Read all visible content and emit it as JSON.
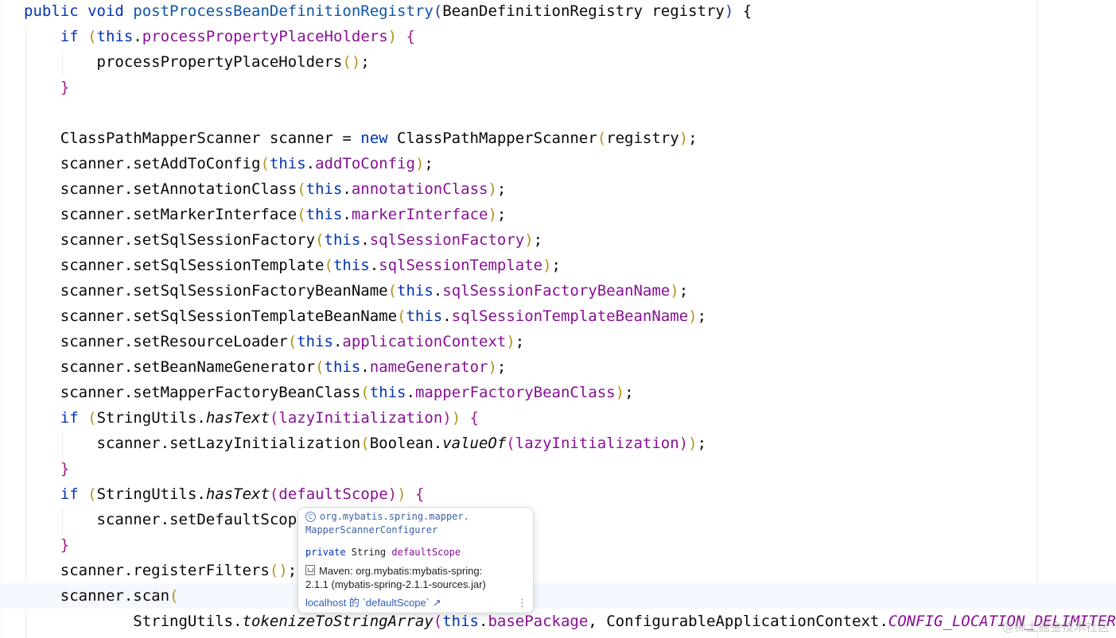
{
  "code": {
    "l1": {
      "a": "public",
      "b": " ",
      "c": "void",
      "d": " postProcessBeanDefinitionRegistry",
      "e": "(",
      "f": "BeanDefinitionRegistry registry",
      "g": ")",
      "h": " {"
    },
    "l2": {
      "ind": "    ",
      "kw": "if",
      "sp": " ",
      "o": "(",
      "th": "this",
      "dot": ".",
      "fld": "processPropertyPlaceHolders",
      "c": ")",
      "rest": " {"
    },
    "l3": {
      "ind": "        ",
      "t": "processPropertyPlaceHolders",
      "o": "(",
      "c": ")",
      "semi": ";"
    },
    "l4": {
      "ind": "    ",
      "b": "}"
    },
    "l6": {
      "ind": "    ",
      "t1": "ClassPathMapperScanner scanner = ",
      "kw": "new",
      "t2": " ClassPathMapperScanner",
      "o": "(",
      "arg": "registry",
      "c": ")",
      "semi": ";"
    },
    "l7": {
      "ind": "    ",
      "m": "scanner.setAddToConfig",
      "o": "(",
      "th": "this",
      "dot": ".",
      "fld": "addToConfig",
      "c": ")",
      "semi": ";"
    },
    "l8": {
      "ind": "    ",
      "m": "scanner.setAnnotationClass",
      "o": "(",
      "th": "this",
      "dot": ".",
      "fld": "annotationClass",
      "c": ")",
      "semi": ";"
    },
    "l9": {
      "ind": "    ",
      "m": "scanner.setMarkerInterface",
      "o": "(",
      "th": "this",
      "dot": ".",
      "fld": "markerInterface",
      "c": ")",
      "semi": ";"
    },
    "l10": {
      "ind": "    ",
      "m": "scanner.setSqlSessionFactory",
      "o": "(",
      "th": "this",
      "dot": ".",
      "fld": "sqlSessionFactory",
      "c": ")",
      "semi": ";"
    },
    "l11": {
      "ind": "    ",
      "m": "scanner.setSqlSessionTemplate",
      "o": "(",
      "th": "this",
      "dot": ".",
      "fld": "sqlSessionTemplate",
      "c": ")",
      "semi": ";"
    },
    "l12": {
      "ind": "    ",
      "m": "scanner.setSqlSessionFactoryBeanName",
      "o": "(",
      "th": "this",
      "dot": ".",
      "fld": "sqlSessionFactoryBeanName",
      "c": ")",
      "semi": ";"
    },
    "l13": {
      "ind": "    ",
      "m": "scanner.setSqlSessionTemplateBeanName",
      "o": "(",
      "th": "this",
      "dot": ".",
      "fld": "sqlSessionTemplateBeanName",
      "c": ")",
      "semi": ";"
    },
    "l14": {
      "ind": "    ",
      "m": "scanner.setResourceLoader",
      "o": "(",
      "th": "this",
      "dot": ".",
      "fld": "applicationContext",
      "c": ")",
      "semi": ";"
    },
    "l15": {
      "ind": "    ",
      "m": "scanner.setBeanNameGenerator",
      "o": "(",
      "th": "this",
      "dot": ".",
      "fld": "nameGenerator",
      "c": ")",
      "semi": ";"
    },
    "l16": {
      "ind": "    ",
      "m": "scanner.setMapperFactoryBeanClass",
      "o": "(",
      "th": "this",
      "dot": ".",
      "fld": "mapperFactoryBeanClass",
      "c": ")",
      "semi": ";"
    },
    "l17": {
      "ind": "    ",
      "kw": "if",
      "sp": " ",
      "o1": "(",
      "t": "StringUtils.",
      "it": "hasText",
      "o2": "(",
      "fld": "lazyInitialization",
      "c2": ")",
      "c1": ")",
      "rest": " {"
    },
    "l18": {
      "ind": "        ",
      "t": "scanner.setLazyInitialization",
      "o1": "(",
      "t2": "Boolean.",
      "it": "valueOf",
      "o2": "(",
      "fld": "lazyInitialization",
      "c2": ")",
      "c1": ")",
      "semi": ";"
    },
    "l19": {
      "ind": "    ",
      "b": "}"
    },
    "l20": {
      "ind": "    ",
      "kw": "if",
      "sp": " ",
      "o1": "(",
      "t": "StringUtils.",
      "it": "hasText",
      "o2": "(",
      "fld": "defaultScope",
      "c2": ")",
      "c1": ")",
      "rest": " {"
    },
    "l21": {
      "ind": "        ",
      "t": "scanner.setDefaultScope"
    },
    "l22": {
      "ind": "    ",
      "b": "}"
    },
    "l23": {
      "ind": "    ",
      "t": "scanner.registerFilters",
      "o": "(",
      "c": ")",
      "semi": ";"
    },
    "l24": {
      "ind": "    ",
      "t": "scanner.scan",
      "o": "("
    },
    "l25": {
      "ind": "            ",
      "t": "StringUtils.",
      "it": "tokenizeToStringArray",
      "o": "(",
      "th": "this",
      "dot": ".",
      "fld": "basePackage",
      "sep": ", ",
      "t2": "ConfigurableApplicationContext.",
      "const": "CONFIG_LOCATION_DELIMITERS",
      "c": ")",
      "semi": ");"
    }
  },
  "popup": {
    "pkg_line1": "org.mybatis.spring.mapper.",
    "pkg_line2": "MapperScannerConfigurer",
    "decl_kw": "private",
    "decl_type": " String ",
    "decl_name": "defaultScope",
    "maven_line1": "Maven: org.mybatis:mybatis-spring:",
    "maven_line2": "2.1.1 (mybatis-spring-2.1.1-sources.jar)",
    "link_text": "localhost 的 `defaultScope`",
    "link_arrow": "↗",
    "more": "⋮"
  },
  "watermark": "@稀土掘金技术社区",
  "icons": [
    "class-icon",
    "jar-icon",
    "external-link-icon",
    "more-options-icon"
  ],
  "colors": {
    "keyword": "#0033b3",
    "field": "#871094",
    "paren_level1": "#b5911f",
    "paren_level2": "#9c1a8a",
    "caret_line": "#f5f8fe"
  }
}
